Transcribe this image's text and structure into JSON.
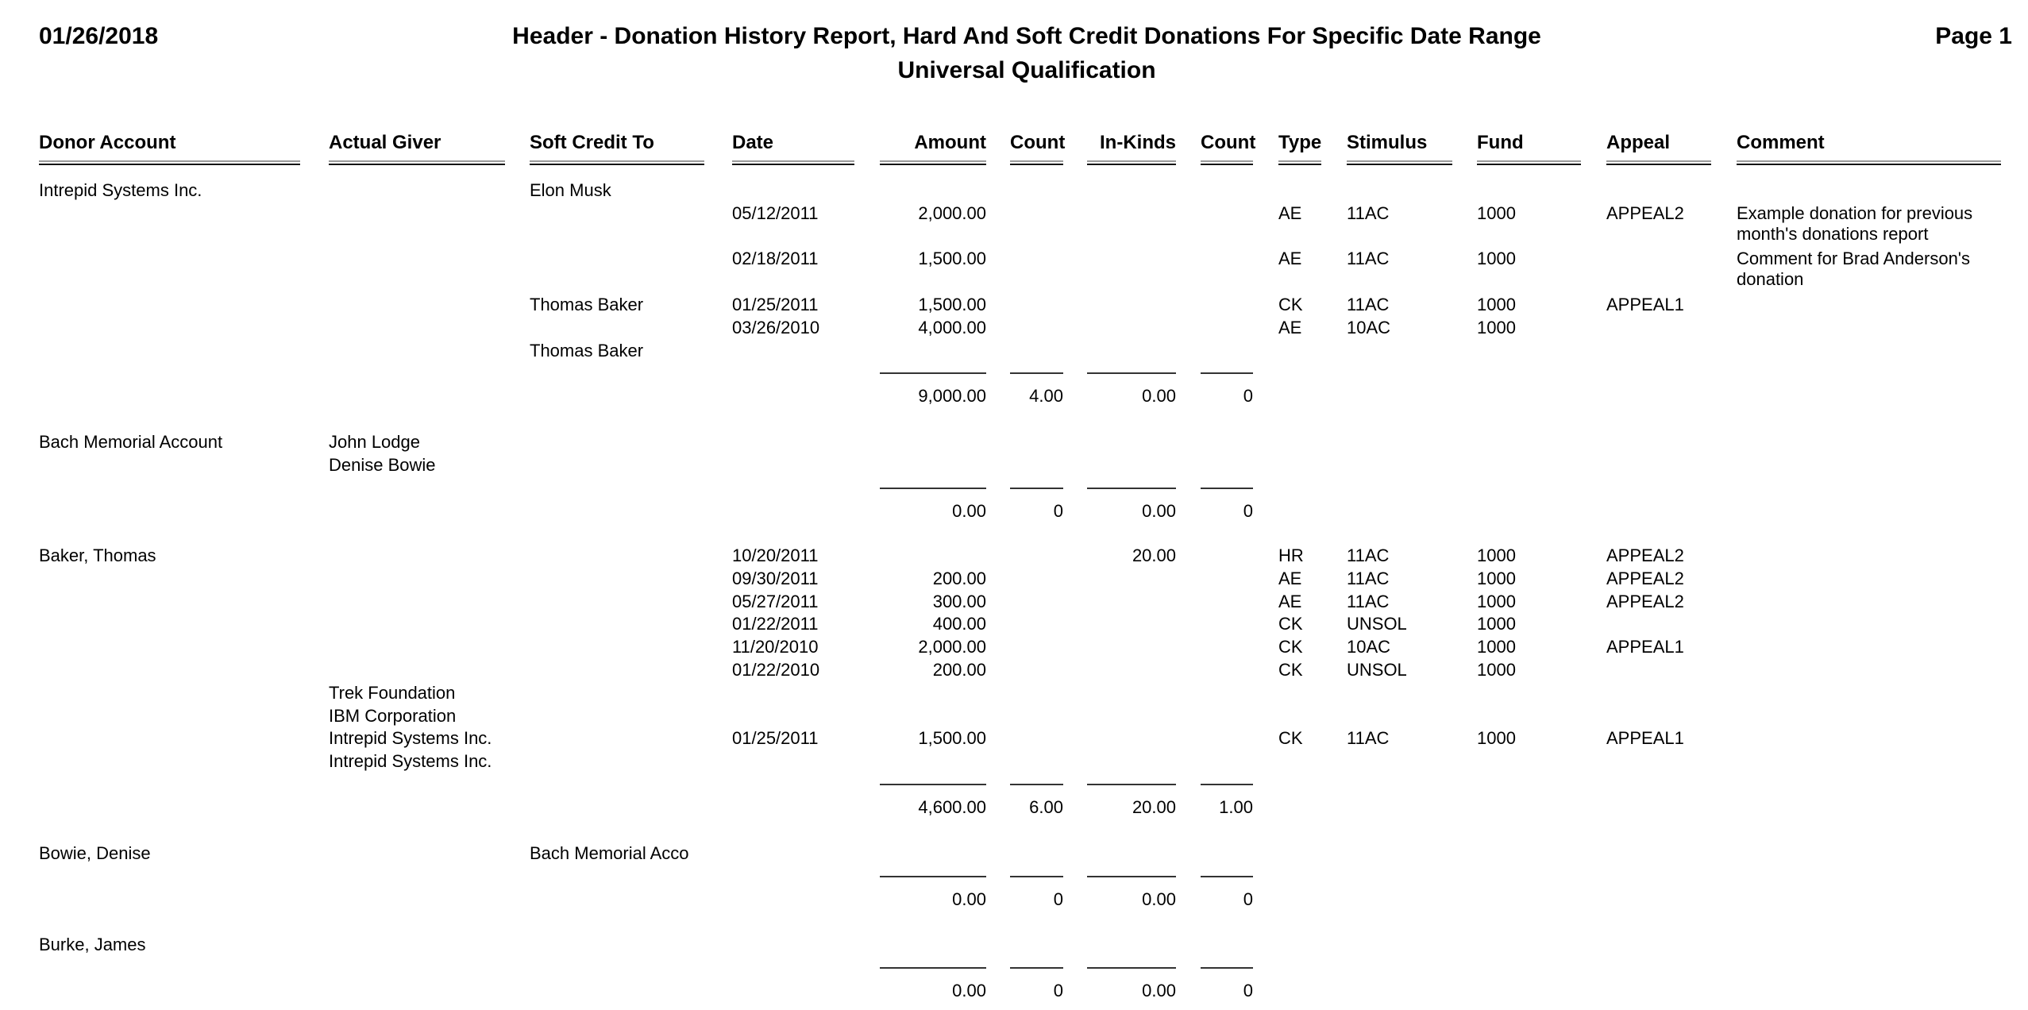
{
  "header": {
    "date": "01/26/2018",
    "title": "Header - Donation History Report, Hard And Soft Credit Donations For Specific Date Range",
    "subtitle": "Universal Qualification",
    "page": "Page 1"
  },
  "columns": {
    "donor_account": "Donor Account",
    "actual_giver": "Actual Giver",
    "soft_credit_to": "Soft Credit To",
    "date": "Date",
    "amount": "Amount",
    "count": "Count",
    "in_kinds": "In-Kinds",
    "count2": "Count",
    "type": "Type",
    "stimulus": "Stimulus",
    "fund": "Fund",
    "appeal": "Appeal",
    "comment": "Comment"
  },
  "groups": [
    {
      "donor_account": "Intrepid Systems Inc.",
      "lines": [
        {
          "actual_giver": "",
          "soft_credit_to": "Elon Musk",
          "date": "",
          "amount": "",
          "in_kinds": "",
          "type": "",
          "stimulus": "",
          "fund": "",
          "appeal": "",
          "comment": ""
        },
        {
          "actual_giver": "",
          "soft_credit_to": "",
          "date": "05/12/2011",
          "amount": "2,000.00",
          "in_kinds": "",
          "type": "AE",
          "stimulus": "11AC",
          "fund": "1000",
          "appeal": "APPEAL2",
          "comment": "Example donation for previous month's donations report"
        },
        {
          "actual_giver": "",
          "soft_credit_to": "",
          "date": "02/18/2011",
          "amount": "1,500.00",
          "in_kinds": "",
          "type": "AE",
          "stimulus": "11AC",
          "fund": "1000",
          "appeal": "",
          "comment": "Comment for Brad Anderson's donation"
        },
        {
          "actual_giver": "",
          "soft_credit_to": "Thomas Baker",
          "date": "01/25/2011",
          "amount": "1,500.00",
          "in_kinds": "",
          "type": "CK",
          "stimulus": "11AC",
          "fund": "1000",
          "appeal": "APPEAL1",
          "comment": ""
        },
        {
          "actual_giver": "",
          "soft_credit_to": "",
          "date": "03/26/2010",
          "amount": "4,000.00",
          "in_kinds": "",
          "type": "AE",
          "stimulus": "10AC",
          "fund": "1000",
          "appeal": "",
          "comment": ""
        },
        {
          "actual_giver": "",
          "soft_credit_to": "Thomas Baker",
          "date": "",
          "amount": "",
          "in_kinds": "",
          "type": "",
          "stimulus": "",
          "fund": "",
          "appeal": "",
          "comment": ""
        }
      ],
      "totals": {
        "amount": "9,000.00",
        "count": "4.00",
        "in_kinds": "0.00",
        "count2": "0"
      }
    },
    {
      "donor_account": "Bach Memorial Account",
      "lines": [
        {
          "actual_giver": "John Lodge",
          "soft_credit_to": "",
          "date": "",
          "amount": "",
          "in_kinds": "",
          "type": "",
          "stimulus": "",
          "fund": "",
          "appeal": "",
          "comment": ""
        },
        {
          "actual_giver": "Denise Bowie",
          "soft_credit_to": "",
          "date": "",
          "amount": "",
          "in_kinds": "",
          "type": "",
          "stimulus": "",
          "fund": "",
          "appeal": "",
          "comment": ""
        }
      ],
      "totals": {
        "amount": "0.00",
        "count": "0",
        "in_kinds": "0.00",
        "count2": "0"
      }
    },
    {
      "donor_account": "Baker, Thomas",
      "lines": [
        {
          "actual_giver": "",
          "soft_credit_to": "",
          "date": "10/20/2011",
          "amount": "",
          "in_kinds": "20.00",
          "type": "HR",
          "stimulus": "11AC",
          "fund": "1000",
          "appeal": "APPEAL2",
          "comment": ""
        },
        {
          "actual_giver": "",
          "soft_credit_to": "",
          "date": "09/30/2011",
          "amount": "200.00",
          "in_kinds": "",
          "type": "AE",
          "stimulus": "11AC",
          "fund": "1000",
          "appeal": "APPEAL2",
          "comment": ""
        },
        {
          "actual_giver": "",
          "soft_credit_to": "",
          "date": "05/27/2011",
          "amount": "300.00",
          "in_kinds": "",
          "type": "AE",
          "stimulus": "11AC",
          "fund": "1000",
          "appeal": "APPEAL2",
          "comment": ""
        },
        {
          "actual_giver": "",
          "soft_credit_to": "",
          "date": "01/22/2011",
          "amount": "400.00",
          "in_kinds": "",
          "type": "CK",
          "stimulus": "UNSOL",
          "fund": "1000",
          "appeal": "",
          "comment": ""
        },
        {
          "actual_giver": "",
          "soft_credit_to": "",
          "date": "11/20/2010",
          "amount": "2,000.00",
          "in_kinds": "",
          "type": "CK",
          "stimulus": "10AC",
          "fund": "1000",
          "appeal": "APPEAL1",
          "comment": ""
        },
        {
          "actual_giver": "",
          "soft_credit_to": "",
          "date": "01/22/2010",
          "amount": "200.00",
          "in_kinds": "",
          "type": "CK",
          "stimulus": "UNSOL",
          "fund": "1000",
          "appeal": "",
          "comment": ""
        },
        {
          "actual_giver": "Trek Foundation",
          "soft_credit_to": "",
          "date": "",
          "amount": "",
          "in_kinds": "",
          "type": "",
          "stimulus": "",
          "fund": "",
          "appeal": "",
          "comment": ""
        },
        {
          "actual_giver": "IBM Corporation",
          "soft_credit_to": "",
          "date": "",
          "amount": "",
          "in_kinds": "",
          "type": "",
          "stimulus": "",
          "fund": "",
          "appeal": "",
          "comment": ""
        },
        {
          "actual_giver": "Intrepid Systems Inc.",
          "soft_credit_to": "",
          "date": "01/25/2011",
          "amount": "1,500.00",
          "in_kinds": "",
          "type": "CK",
          "stimulus": "11AC",
          "fund": "1000",
          "appeal": "APPEAL1",
          "comment": ""
        },
        {
          "actual_giver": "Intrepid Systems Inc.",
          "soft_credit_to": "",
          "date": "",
          "amount": "",
          "in_kinds": "",
          "type": "",
          "stimulus": "",
          "fund": "",
          "appeal": "",
          "comment": ""
        }
      ],
      "totals": {
        "amount": "4,600.00",
        "count": "6.00",
        "in_kinds": "20.00",
        "count2": "1.00"
      }
    },
    {
      "donor_account": "Bowie, Denise",
      "lines": [
        {
          "actual_giver": "",
          "soft_credit_to": "Bach Memorial Acco",
          "date": "",
          "amount": "",
          "in_kinds": "",
          "type": "",
          "stimulus": "",
          "fund": "",
          "appeal": "",
          "comment": ""
        }
      ],
      "totals": {
        "amount": "0.00",
        "count": "0",
        "in_kinds": "0.00",
        "count2": "0"
      }
    },
    {
      "donor_account": "Burke, James",
      "lines": [],
      "totals": {
        "amount": "0.00",
        "count": "0",
        "in_kinds": "0.00",
        "count2": "0"
      }
    }
  ]
}
